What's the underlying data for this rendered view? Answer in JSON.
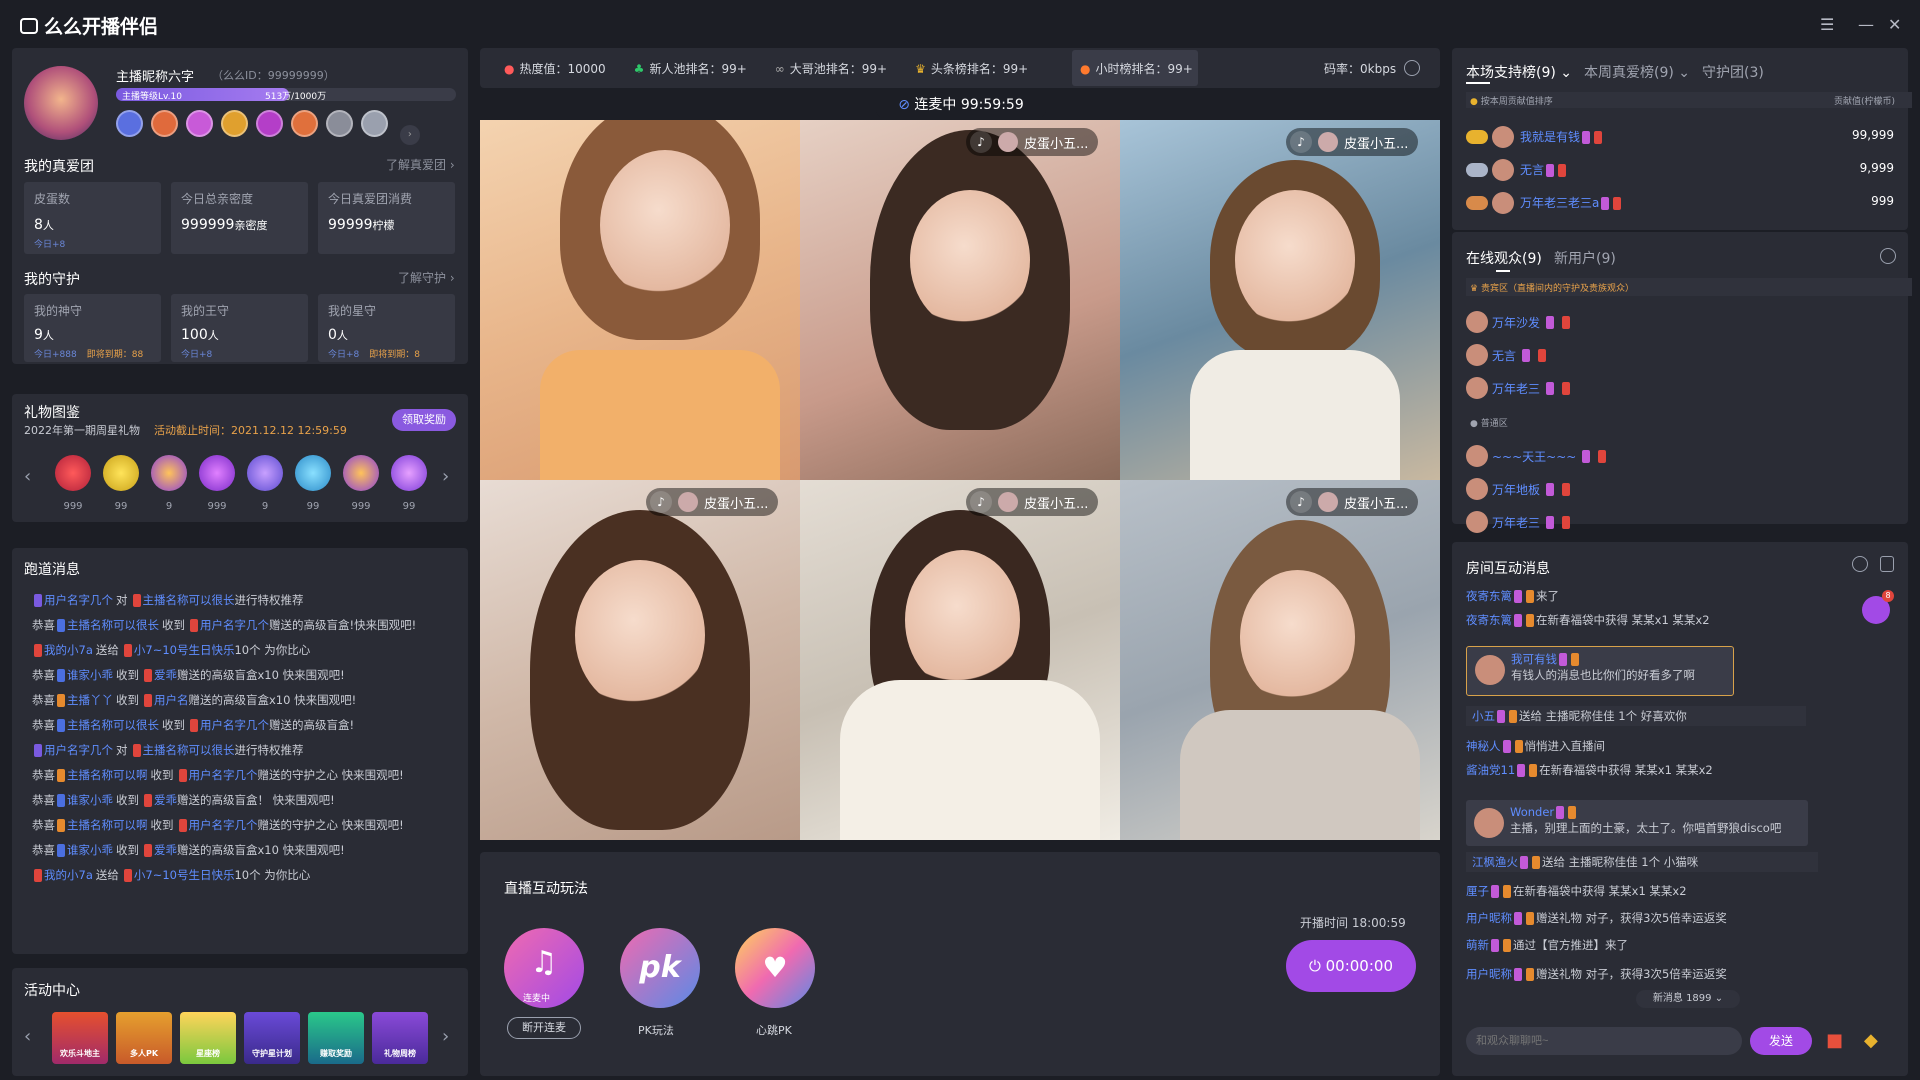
{
  "app": {
    "title": "么么开播伴侣"
  },
  "profile": {
    "name": "主播昵称六字",
    "id": "（么么ID：99999999）",
    "level": "主播等级Lv.10",
    "level_progress": "513万/1000万",
    "level_fill": 0.51
  },
  "fan": {
    "title": "我的真爱团",
    "more": "了解真爱团",
    "cards": [
      {
        "label": "皮蛋数",
        "value": "8",
        "unit": "人",
        "sub": "今日+8"
      },
      {
        "label": "今日总亲密度",
        "value": "999999",
        "unit": "亲密度",
        "sub": ""
      },
      {
        "label": "今日真爱团消费",
        "value": "99999",
        "unit": "柠檬",
        "sub": ""
      }
    ]
  },
  "guard": {
    "title": "我的守护",
    "more": "了解守护",
    "cards": [
      {
        "label": "我的神守",
        "value": "9",
        "unit": "人",
        "sub": "今日+888",
        "exp": "即将到期：88"
      },
      {
        "label": "我的王守",
        "value": "100",
        "unit": "人",
        "sub": "今日+8",
        "exp": ""
      },
      {
        "label": "我的星守",
        "value": "0",
        "unit": "人",
        "sub": "今日+8",
        "exp": "即将到期：8"
      }
    ]
  },
  "gifts": {
    "title": "礼物图鉴",
    "subtitle": "2022年第一期周星礼物",
    "deadline": "活动截止时间：2021.12.12 12:59:59",
    "claim": "领取奖励",
    "counts": [
      "999",
      "99",
      "9",
      "999",
      "9",
      "99",
      "999",
      "99"
    ]
  },
  "runway": {
    "title": "跑道消息",
    "lines": [
      {
        "pre": "",
        "a": "用户名字几个",
        "mid": "对",
        "b": "主播名称可以很长",
        "post": "进行特权推荐"
      },
      {
        "pre": "恭喜",
        "a": "主播名称可以很长",
        "mid": "收到",
        "b": "用户名字几个",
        "post": "赠送的高级盲盒!快来围观吧!"
      },
      {
        "pre": "",
        "a": "我的小7a",
        "mid": "送给",
        "b": "小7~10号生日快乐",
        "post": "10个 为你比心"
      },
      {
        "pre": "恭喜",
        "a": "谁家小乖",
        "mid": "收到",
        "b": "爱乖",
        "post": "赠送的高级盲盒x10 快来围观吧!"
      },
      {
        "pre": "恭喜",
        "a": "主播丫丫",
        "mid": "收到",
        "b": "用户名",
        "post": "赠送的高级盲盒x10 快来围观吧!"
      },
      {
        "pre": "恭喜",
        "a": "主播名称可以很长",
        "mid": "收到",
        "b": "用户名字几个",
        "post": "赠送的高级盲盒!"
      },
      {
        "pre": "",
        "a": "用户名字几个",
        "mid": "对",
        "b": "主播名称可以很长",
        "post": "进行特权推荐"
      },
      {
        "pre": "恭喜",
        "a": "主播名称可以啊",
        "mid": "收到",
        "b": "用户名字几个",
        "post": "赠送的守护之心 快来围观吧!"
      },
      {
        "pre": "恭喜",
        "a": "谁家小乖",
        "mid": "收到",
        "b": "爱乖",
        "post": "赠送的高级盲盒！ 快来围观吧!"
      },
      {
        "pre": "恭喜",
        "a": "主播名称可以啊",
        "mid": "收到",
        "b": "用户名字几个",
        "post": "赠送的守护之心 快来围观吧!"
      },
      {
        "pre": "恭喜",
        "a": "谁家小乖",
        "mid": "收到",
        "b": "爱乖",
        "post": "赠送的高级盲盒x10 快来围观吧!"
      },
      {
        "pre": "",
        "a": "我的小7a",
        "mid": "送给",
        "b": "小7~10号生日快乐",
        "post": "10个 为你比心"
      }
    ]
  },
  "activity": {
    "title": "活动中心",
    "items": [
      "欢乐斗地主",
      "多人PK",
      "星座榜",
      "守护星计划",
      "赚取奖励",
      "礼物周榜"
    ]
  },
  "stats": {
    "heat": "热度值：10000",
    "newpool": "新人池排名：99+",
    "bigbro": "大哥池排名：99+",
    "headline": "头条榜排名：99+",
    "hourly": "小时榜排名：99+",
    "bitrate": "码率：0kbps"
  },
  "live": {
    "status": "连麦中 99:59:59",
    "guest": "皮蛋小五..."
  },
  "interact": {
    "title": "直播互动玩法",
    "start_time": "开播时间 18:00:59",
    "timer": "00:00:00",
    "items": [
      {
        "name": "断开连麦",
        "badge": "连麦中"
      },
      {
        "name": "PK玩法"
      },
      {
        "name": "心跳PK"
      }
    ]
  },
  "rank": {
    "tabs": [
      "本场支持榜(9)",
      "本周真爱榜(9)",
      "守护团(3)"
    ],
    "note": "按本周贡献值排序",
    "col": "贡献值(柠檬币)",
    "rows": [
      {
        "name": "我就是有钱",
        "score": "99,999"
      },
      {
        "name": "无言",
        "score": "9,999"
      },
      {
        "name": "万年老三老三a",
        "score": "999"
      }
    ]
  },
  "audience": {
    "tabs": [
      "在线观众(9)",
      "新用户(9)"
    ],
    "vip_zone": "贵宾区（直播间内的守护及贵族观众）",
    "normal_zone": "普通区",
    "vip": [
      "万年沙发",
      "无言",
      "万年老三"
    ],
    "normal": [
      "~~~天王~~~",
      "万年地板",
      "万年老三"
    ]
  },
  "room": {
    "title": "房间互动消息",
    "new_msg": "新消息 1899",
    "unread": "8",
    "placeholder": "和观众聊聊吧~",
    "send": "发送",
    "msgs": [
      {
        "n": "夜寄东篱",
        "t": "来了"
      },
      {
        "n": "夜寄东篱",
        "t": "在新春福袋中获得  某某x1 某某x2"
      },
      {
        "n": "我可有钱",
        "t": "有钱人的消息也比你们的好看多了啊"
      },
      {
        "n": "小五",
        "t": "送给 主播昵称佳佳 1个 好喜欢你"
      },
      {
        "n": "神秘人",
        "t": "悄悄进入直播间"
      },
      {
        "n": "酱油党11",
        "t": "在新春福袋中获得  某某x1 某某x2"
      },
      {
        "n": "Wonder",
        "t": "主播，别理上面的土豪，太土了。你唱首野狼disco吧"
      },
      {
        "n": "江枫渔火",
        "t": "送给 主播昵称佳佳 1个 小猫咪"
      },
      {
        "n": "厘子",
        "t": "在新春福袋中获得  某某x1 某某x2"
      },
      {
        "n": "用户昵称",
        "t": "赠送礼物 对子，获得3次5倍幸运返奖"
      },
      {
        "n": "萌新",
        "t": "通过【官方推进】来了"
      },
      {
        "n": "用户昵称",
        "t": "赠送礼物 对子，获得3次5倍幸运返奖"
      }
    ]
  }
}
